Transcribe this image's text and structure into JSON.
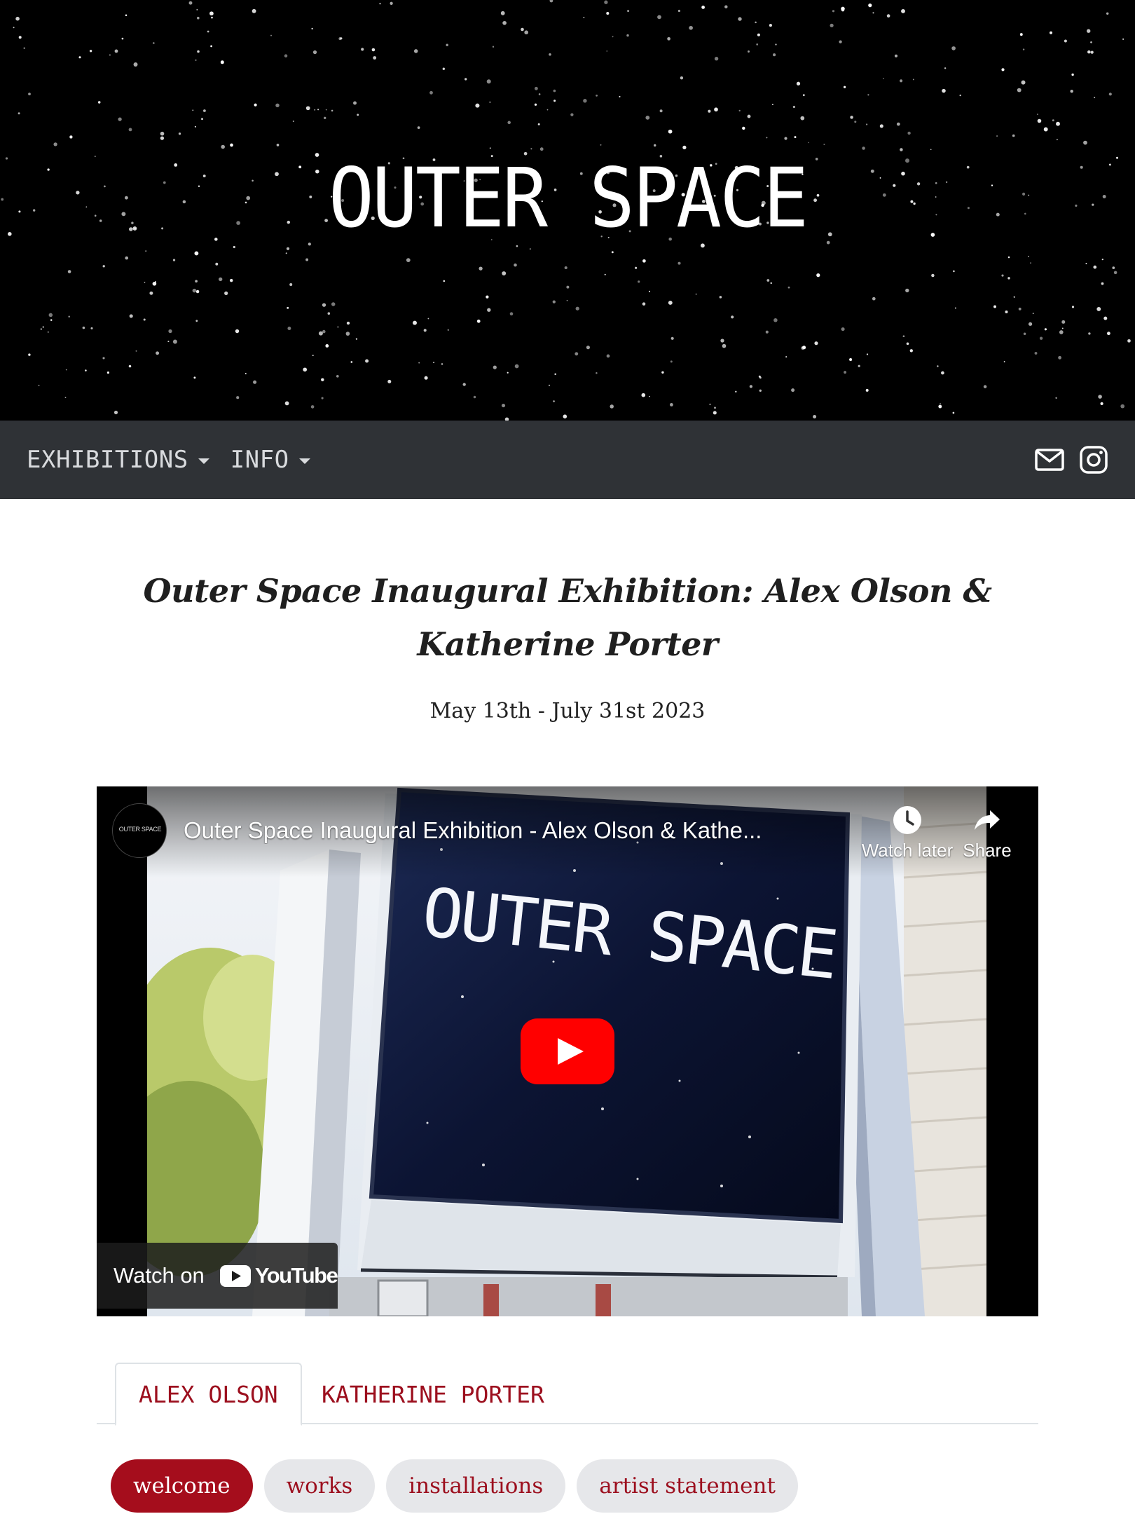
{
  "site": {
    "title": "OUTER SPACE"
  },
  "nav": {
    "items": [
      {
        "label": "EXHIBITIONS",
        "icon": "caret-down-icon"
      },
      {
        "label": "INFO",
        "icon": "caret-down-icon"
      }
    ],
    "icons": [
      "mail-icon",
      "instagram-icon"
    ]
  },
  "exhibition": {
    "title": "Outer Space Inaugural Exhibition: Alex Olson & Katherine Porter",
    "dates": "May 13th - July 31st 2023"
  },
  "video": {
    "channel_avatar_text": "OUTER SPACE",
    "title": "Outer Space Inaugural Exhibition - Alex Olson & Kathe...",
    "watch_later": "Watch later",
    "share": "Share",
    "watch_on": "Watch on",
    "youtube": "YouTube",
    "sign_text": "OUTER SPACE"
  },
  "tabs": [
    {
      "label": "ALEX OLSON",
      "active": true
    },
    {
      "label": "KATHERINE PORTER",
      "active": false
    }
  ],
  "pills": [
    {
      "label": "welcome",
      "active": true
    },
    {
      "label": "works",
      "active": false
    },
    {
      "label": "installations",
      "active": false
    },
    {
      "label": "artist statement",
      "active": false
    }
  ],
  "colors": {
    "navbar": "#2f3236",
    "accent": "#a50d1c",
    "link": "#9c0f1e",
    "pill_bg": "#e6e7ea",
    "youtube_red": "#ff0000"
  }
}
